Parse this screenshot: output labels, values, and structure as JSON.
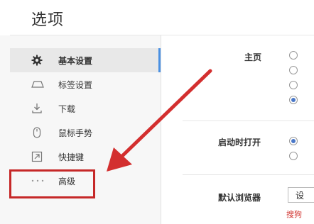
{
  "window": {
    "title": "选项"
  },
  "sidebar": {
    "items": [
      {
        "label": "基本设置",
        "icon": "gear-icon",
        "active": true
      },
      {
        "label": "标签设置",
        "icon": "tab-icon",
        "active": false
      },
      {
        "label": "下载",
        "icon": "download-icon",
        "active": false
      },
      {
        "label": "鼠标手势",
        "icon": "mouse-icon",
        "active": false
      },
      {
        "label": "快捷键",
        "icon": "shortcut-icon",
        "active": false
      },
      {
        "label": "高级",
        "icon": "more-icon",
        "active": false
      }
    ]
  },
  "main": {
    "homepage": {
      "label": "主页",
      "selected_index": 3,
      "option_count": 4
    },
    "startup": {
      "label": "启动时打开",
      "selected_index": 0,
      "option_count": 2
    },
    "default_browser": {
      "label": "默认浏览器",
      "button_label": "设",
      "note": "搜狗"
    }
  },
  "annotation": {
    "color": "#c62828",
    "highlight_target": "高级"
  },
  "colors": {
    "accent": "#4a90e2",
    "radio_checked": "#4a78c8",
    "note_red": "#d0312d"
  }
}
